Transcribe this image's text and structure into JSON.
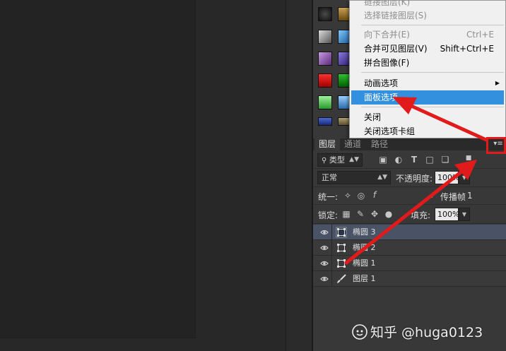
{
  "context_menu": {
    "items": [
      {
        "label": "链接图层(K)",
        "shortcut": "",
        "disabled": true
      },
      {
        "label": "选择链接图层(S)",
        "shortcut": "",
        "disabled": true
      },
      {
        "label": "向下合并(E)",
        "shortcut": "Ctrl+E",
        "disabled": true
      },
      {
        "label": "合并可见图层(V)",
        "shortcut": "Shift+Ctrl+E",
        "disabled": false
      },
      {
        "label": "拼合图像(F)",
        "shortcut": "",
        "disabled": false
      },
      {
        "label": "动画选项",
        "shortcut": "",
        "disabled": false,
        "submenu": true
      },
      {
        "label": "面板选项...",
        "shortcut": "",
        "disabled": false,
        "highlighted": true
      },
      {
        "label": "关闭",
        "shortcut": "",
        "disabled": false
      },
      {
        "label": "关闭选项卡组",
        "shortcut": "",
        "disabled": false
      }
    ]
  },
  "layers_panel": {
    "tabs": [
      "图层",
      "通道",
      "路径"
    ],
    "menu_icon": "panel-menu-icon",
    "filter": {
      "label": "类型",
      "icon": "search-icon"
    },
    "blend_mode": "正常",
    "opacity_label": "不透明度:",
    "opacity_value": "100%",
    "unify_label": "统一:",
    "propagate_label": "传播帧",
    "propagate_value": "1",
    "lock_label": "锁定:",
    "fill_label": "填充:",
    "fill_value": "100%",
    "layers": [
      {
        "name": "椭圆 3",
        "type": "shape",
        "selected": true
      },
      {
        "name": "椭圆 2",
        "type": "shape",
        "selected": false
      },
      {
        "name": "椭圆 1",
        "type": "shape",
        "selected": false
      },
      {
        "name": "图层 1",
        "type": "brush",
        "selected": false
      }
    ]
  },
  "annotation": {
    "color": "#e11b1b"
  },
  "watermark": {
    "text": "知乎 @huga0123"
  }
}
